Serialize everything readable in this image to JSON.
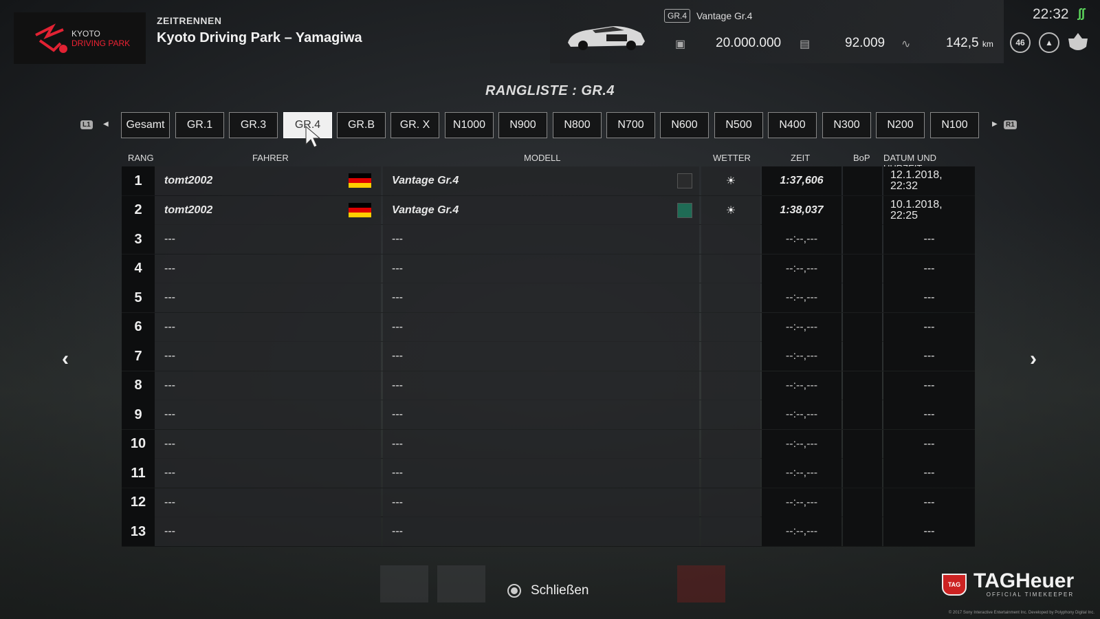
{
  "header": {
    "logo_line1": "KYOTO",
    "logo_line2": "DRIVING PARK",
    "mode": "ZEITRENNEN",
    "track": "Kyoto Driving Park – Yamagiwa"
  },
  "car": {
    "badge": "GR.4",
    "name": "Vantage Gr.4",
    "credits": "20.000.000",
    "mileage_points": "92.009",
    "distance": "142,5",
    "distance_unit": "km",
    "level": "46"
  },
  "clock": "22:32",
  "heading": "RANGLISTE : GR.4",
  "tabs": {
    "l1": "L1",
    "r1": "R1",
    "items": [
      "Gesamt",
      "GR.1",
      "GR.3",
      "GR.4",
      "GR.B",
      "GR. X",
      "N1000",
      "N900",
      "N800",
      "N700",
      "N600",
      "N500",
      "N400",
      "N300",
      "N200",
      "N100"
    ],
    "active_index": 3
  },
  "columns": {
    "rank": "RANG",
    "driver": "FAHRER",
    "model": "MODELL",
    "weather": "WETTER",
    "time": "ZEIT",
    "bop": "BoP",
    "datetime": "DATUM UND UHRZEIT"
  },
  "rows": [
    {
      "rank": "1",
      "driver": "tomt2002",
      "model": "Vantage Gr.4",
      "weather": "☀",
      "time": "1:37,606",
      "date": "12.1.2018,",
      "clock": "22:32",
      "swatch": "#2a2b2c",
      "flag": true
    },
    {
      "rank": "2",
      "driver": "tomt2002",
      "model": "Vantage Gr.4",
      "weather": "☀",
      "time": "1:38,037",
      "date": "10.1.2018,",
      "clock": "22:25",
      "swatch": "#1f6b55",
      "flag": true
    },
    {
      "rank": "3",
      "driver": "---",
      "model": "---",
      "weather": "",
      "time": "--:--,---",
      "date": "---",
      "clock": ""
    },
    {
      "rank": "4",
      "driver": "---",
      "model": "---",
      "weather": "",
      "time": "--:--,---",
      "date": "---",
      "clock": ""
    },
    {
      "rank": "5",
      "driver": "---",
      "model": "---",
      "weather": "",
      "time": "--:--,---",
      "date": "---",
      "clock": ""
    },
    {
      "rank": "6",
      "driver": "---",
      "model": "---",
      "weather": "",
      "time": "--:--,---",
      "date": "---",
      "clock": ""
    },
    {
      "rank": "7",
      "driver": "---",
      "model": "---",
      "weather": "",
      "time": "--:--,---",
      "date": "---",
      "clock": ""
    },
    {
      "rank": "8",
      "driver": "---",
      "model": "---",
      "weather": "",
      "time": "--:--,---",
      "date": "---",
      "clock": ""
    },
    {
      "rank": "9",
      "driver": "---",
      "model": "---",
      "weather": "",
      "time": "--:--,---",
      "date": "---",
      "clock": ""
    },
    {
      "rank": "10",
      "driver": "---",
      "model": "---",
      "weather": "",
      "time": "--:--,---",
      "date": "---",
      "clock": ""
    },
    {
      "rank": "11",
      "driver": "---",
      "model": "---",
      "weather": "",
      "time": "--:--,---",
      "date": "---",
      "clock": ""
    },
    {
      "rank": "12",
      "driver": "---",
      "model": "---",
      "weather": "",
      "time": "--:--,---",
      "date": "---",
      "clock": ""
    },
    {
      "rank": "13",
      "driver": "---",
      "model": "---",
      "weather": "",
      "time": "--:--,---",
      "date": "---",
      "clock": ""
    }
  ],
  "nav": {
    "prev": "‹",
    "next": "›"
  },
  "footer": {
    "close_label": "Schließen",
    "brand": "TAGHeuer",
    "brand_shield": "TAG",
    "brand_sub": "OFFICIAL TIMEKEEPER",
    "copyright": "© 2017 Sony Interactive Entertainment Inc. Developed by Polyphony Digital Inc."
  },
  "colors": {
    "accent_red": "#e22233",
    "active_tab": "#f0f0f0",
    "flag_black": "#000000",
    "flag_red": "#dd0000",
    "flag_gold": "#ffce00"
  }
}
